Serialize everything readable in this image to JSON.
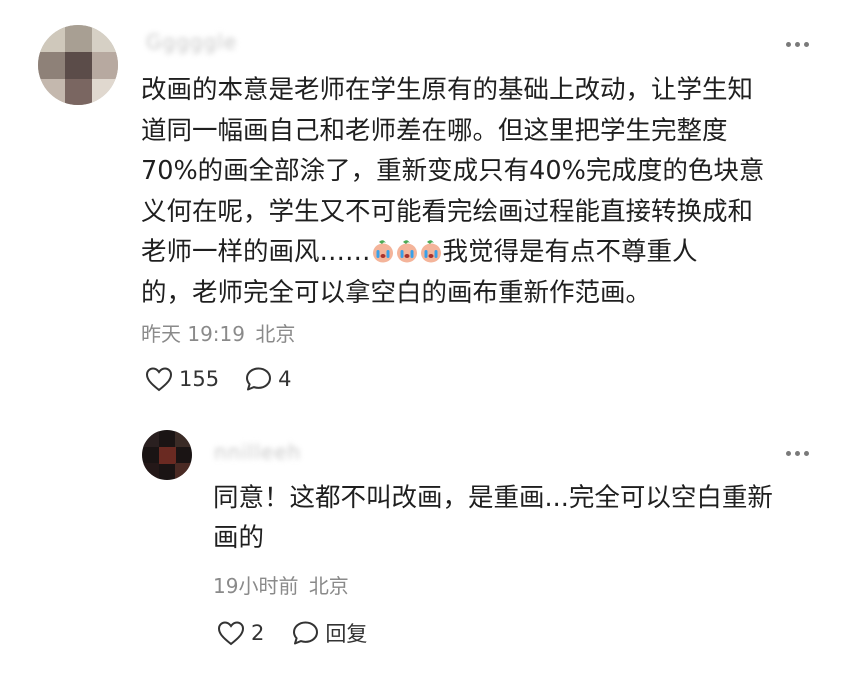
{
  "comment": {
    "username": "Gggggle",
    "text_lines": [
      "改画的本意是老师在学生原有的基础上改动，让学生知",
      "道同一幅画自己和老师差在哪。但这里把学生完整度",
      "70%的画全部涂了，重新变成只有40%完成度的色块意",
      "义何在呢，学生又不可能看完绘画过程能直接转换成和"
    ],
    "line5_before": "老师一样的画风……",
    "line5_after": "我觉得是有点不尊重人",
    "line6": "的，老师完全可以拿空白的画布重新作范画。",
    "emoji": [
      "crying-face-icon",
      "crying-face-icon",
      "crying-face-icon"
    ],
    "time": "昨天 19:19",
    "location": "北京",
    "likes": "155",
    "replies": "4"
  },
  "reply": {
    "username": "nnilleeh",
    "text_lines": [
      "同意！这都不叫改画，是重画...完全可以空白重新",
      "画的"
    ],
    "time": "19小时前",
    "location": "北京",
    "likes": "2",
    "reply_label": "回复"
  },
  "colors": {
    "meta": "#8a8a8a",
    "text": "#1f1f1f",
    "icon": "#333333"
  }
}
